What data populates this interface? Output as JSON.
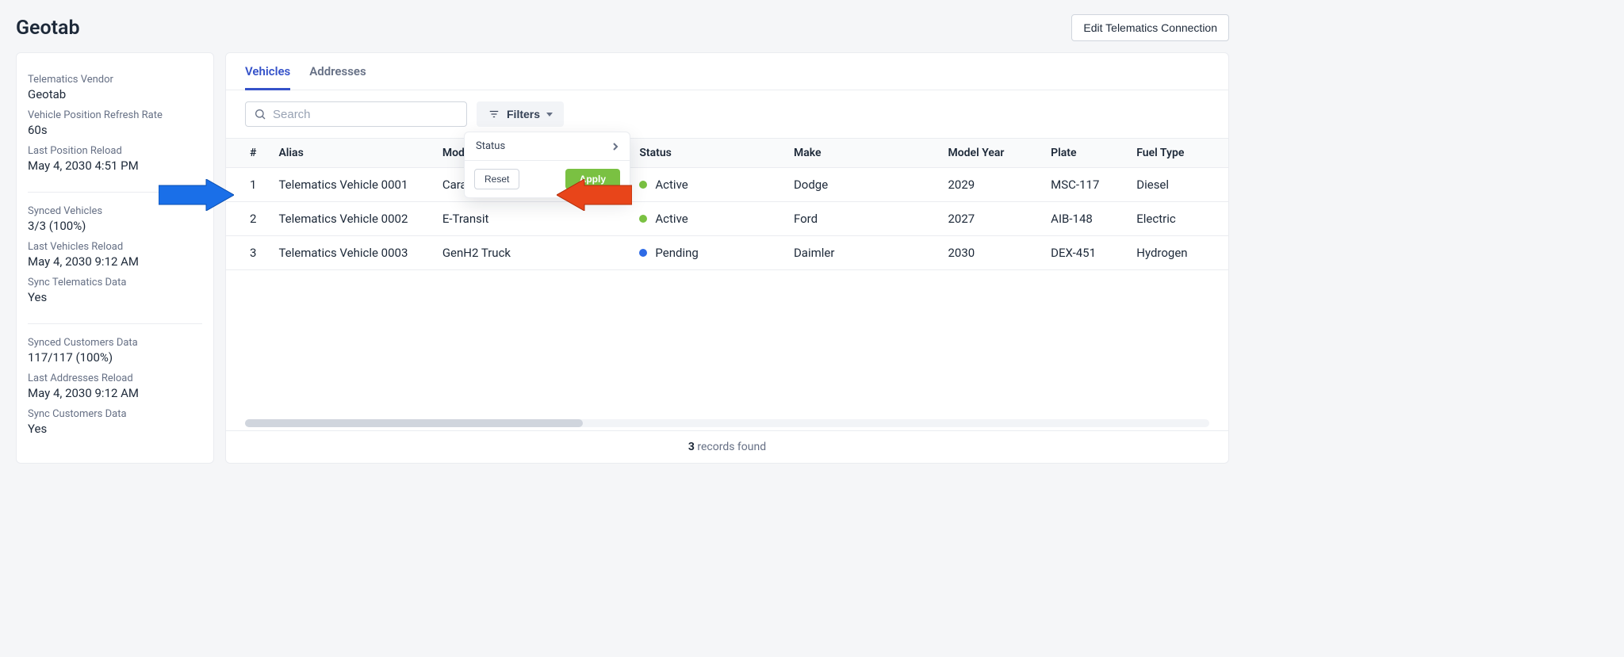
{
  "page": {
    "title": "Geotab",
    "edit_button": "Edit Telematics Connection"
  },
  "sidebar": {
    "groups": [
      [
        {
          "label": "Telematics Vendor",
          "value": "Geotab"
        },
        {
          "label": "Vehicle Position Refresh Rate",
          "value": "60s"
        },
        {
          "label": "Last Position Reload",
          "value": "May 4, 2030 4:51 PM"
        }
      ],
      [
        {
          "label": "Synced Vehicles",
          "value": "3/3 (100%)"
        },
        {
          "label": "Last Vehicles Reload",
          "value": "May 4, 2030 9:12 AM"
        },
        {
          "label": "Sync Telematics Data",
          "value": "Yes"
        }
      ],
      [
        {
          "label": "Synced Customers Data",
          "value": "117/117 (100%)"
        },
        {
          "label": "Last Addresses Reload",
          "value": "May 4, 2030 9:12 AM"
        },
        {
          "label": "Sync Customers Data",
          "value": "Yes"
        }
      ]
    ]
  },
  "tabs": {
    "vehicles": "Vehicles",
    "addresses": "Addresses",
    "active": "vehicles"
  },
  "toolbar": {
    "search_placeholder": "Search",
    "filters_label": "Filters"
  },
  "filter_dropdown": {
    "option_status": "Status",
    "reset": "Reset",
    "apply": "Apply"
  },
  "table": {
    "columns": [
      "#",
      "Alias",
      "Model",
      "Status",
      "Make",
      "Model Year",
      "Plate",
      "Fuel Type"
    ],
    "rows": [
      {
        "n": "1",
        "alias": "Telematics Vehicle 0001",
        "model": "Caravan",
        "status": "Active",
        "status_color": "#7ac142",
        "make": "Dodge",
        "year": "2029",
        "plate": "MSC-117",
        "fuel": "Diesel"
      },
      {
        "n": "2",
        "alias": "Telematics Vehicle 0002",
        "model": "E-Transit",
        "status": "Active",
        "status_color": "#7ac142",
        "make": "Ford",
        "year": "2027",
        "plate": "AIB-148",
        "fuel": "Electric"
      },
      {
        "n": "3",
        "alias": "Telematics Vehicle 0003",
        "model": "GenH2 Truck",
        "status": "Pending",
        "status_color": "#2e6be6",
        "make": "Daimler",
        "year": "2030",
        "plate": "DEX-451",
        "fuel": "Hydrogen"
      }
    ],
    "footer_count": "3",
    "footer_text": "records found"
  },
  "annotations": {
    "blue_arrow": "points-to-search",
    "red_arrow": "points-to-filters"
  }
}
